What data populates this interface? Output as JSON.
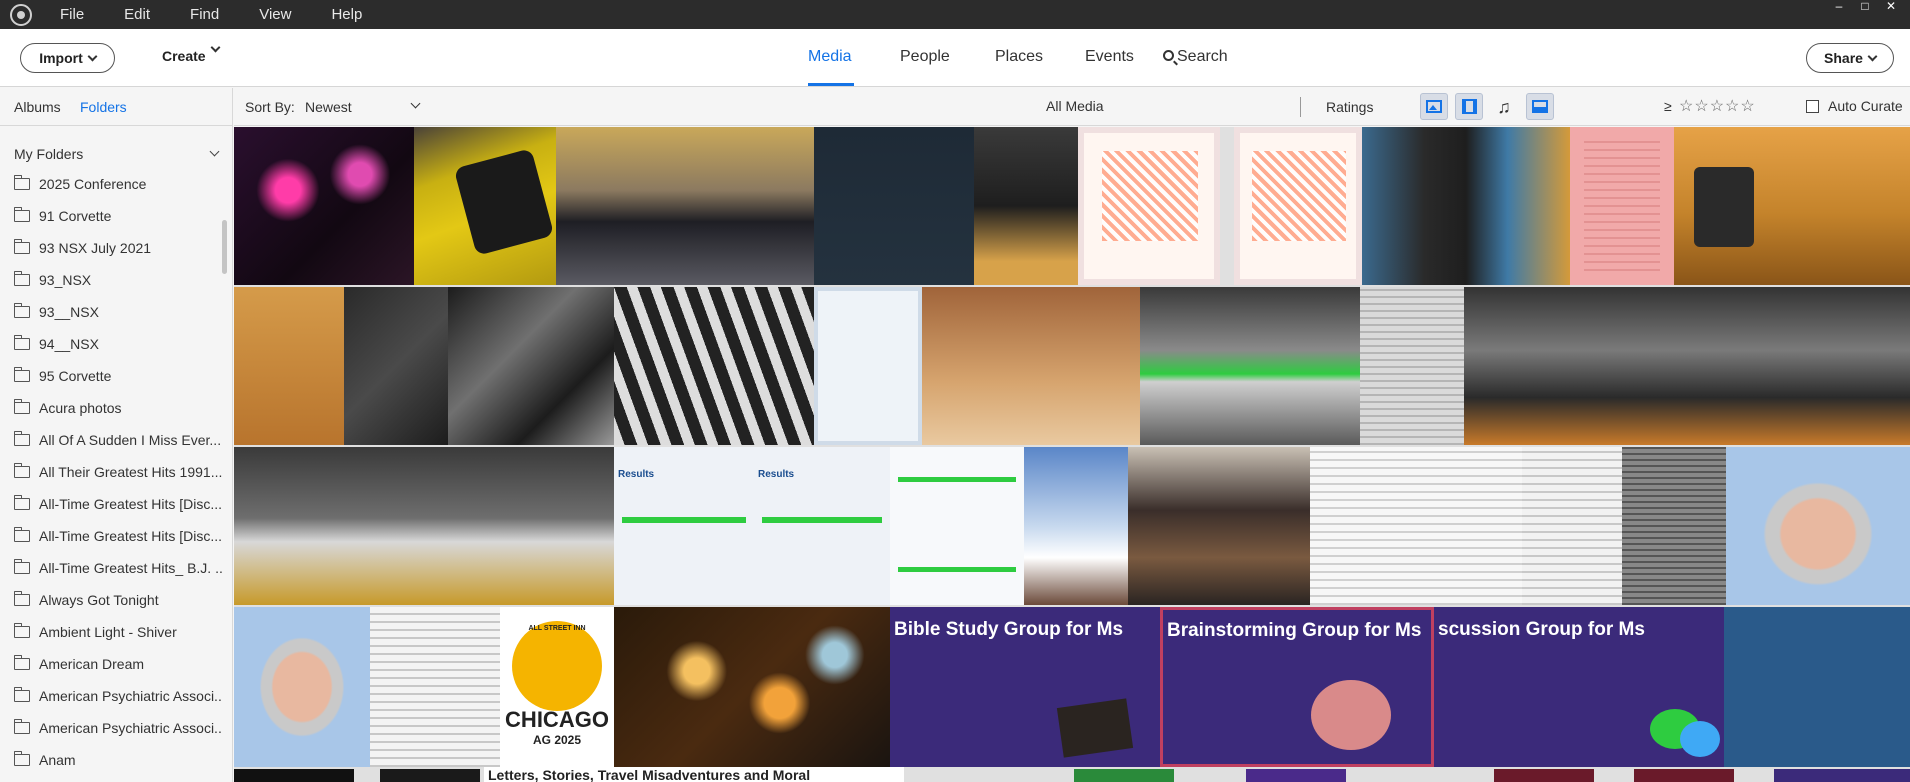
{
  "menu": [
    "File",
    "Edit",
    "Find",
    "View",
    "Help"
  ],
  "window_controls": [
    "‒",
    "□",
    "✕"
  ],
  "topnav": {
    "import_label": "Import",
    "create_label": "Create",
    "share_label": "Share",
    "tabs": [
      "Media",
      "People",
      "Places",
      "Events",
      "Search"
    ],
    "active_tab": "Media"
  },
  "left_panel": {
    "tabs": [
      "Albums",
      "Folders"
    ],
    "active_tab": "Folders",
    "section_title": "My Folders",
    "folders": [
      "2025 Conference",
      "91 Corvette",
      "93 NSX July 2021",
      "93_NSX",
      "93__NSX",
      "94__NSX",
      "95 Corvette",
      "Acura photos",
      "All Of A Sudden I Miss Ever...",
      "All Their Greatest Hits 1991...",
      "All-Time Greatest Hits [Disc...",
      "All-Time Greatest Hits [Disc...",
      "All-Time Greatest Hits_ B.J. ...",
      "Always Got Tonight",
      "Ambient Light - Shiver",
      "American Dream",
      "American Psychiatric Associ...",
      "American Psychiatric Associ...",
      "Anam"
    ]
  },
  "sortbar": {
    "sort_label": "Sort By:",
    "sort_value": "Newest",
    "view_title": "All Media",
    "ratings_label": "Ratings",
    "ratings_op": "≥",
    "stars": "☆☆☆☆☆",
    "auto_curate_label": "Auto Curate",
    "audio_glyph": "♫"
  },
  "grid_text": {
    "chicago_top": "ALL STREET INN",
    "chicago_main": "CHICAGO",
    "chicago_sub": "AG 2025",
    "banner_1": "Bible Study Group for Ms",
    "banner_2": "Brainstorming Group for Ms",
    "banner_3": "scussion Group for Ms",
    "results_1": "Results",
    "results_2": "Results",
    "row5_text": "Letters, Stories, Travel Misadventures and Moral"
  },
  "colors": {
    "accent": "#1473e6",
    "titlebar": "#2c2c2c",
    "banner_purple": "#3b2a7a"
  }
}
